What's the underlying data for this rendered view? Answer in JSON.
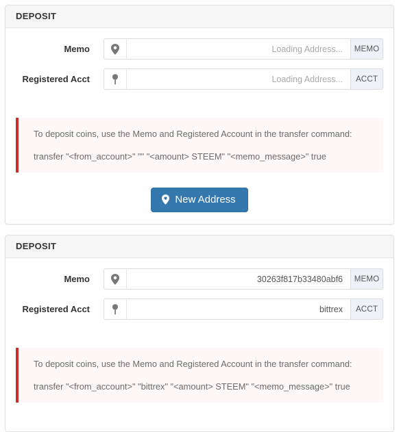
{
  "panels": [
    {
      "title": "DEPOSIT",
      "fields": [
        {
          "label": "Memo",
          "icon": "map-marker-icon",
          "value": "",
          "placeholder": "Loading Address...",
          "addon": "MEMO"
        },
        {
          "label": "Registered Acct",
          "icon": "map-pin-icon",
          "value": "",
          "placeholder": "Loading Address...",
          "addon": "ACCT"
        }
      ],
      "alert": {
        "line1": "To deposit coins, use the Memo and Registered Account in the transfer command:",
        "line2": "transfer \"<from_account>\" \"\" \"<amount> STEEM\" \"<memo_message>\" true"
      },
      "button": {
        "label": "New Address",
        "icon": "map-marker-icon"
      }
    },
    {
      "title": "DEPOSIT",
      "fields": [
        {
          "label": "Memo",
          "icon": "map-marker-icon",
          "value": "30263f817b33480abf6",
          "placeholder": "",
          "addon": "MEMO"
        },
        {
          "label": "Registered Acct",
          "icon": "map-pin-icon",
          "value": "bittrex",
          "placeholder": "",
          "addon": "ACCT"
        }
      ],
      "alert": {
        "line1": "To deposit coins, use the Memo and Registered Account in the transfer command:",
        "line2": "transfer \"<from_account>\" \"bittrex\" \"<amount> STEEM\" \"<memo_message>\" true"
      },
      "button": null
    }
  ],
  "colors": {
    "primary": "#3478ad",
    "alert_border": "#c9302c",
    "alert_bg": "#fdf7f7",
    "panel_heading_bg": "#f5f5f5",
    "addon_bg": "#eef1f5"
  }
}
